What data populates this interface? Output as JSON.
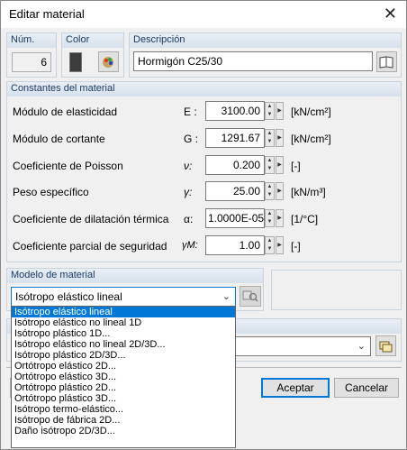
{
  "window": {
    "title": "Editar material",
    "close_glyph": "✕"
  },
  "header": {
    "num_label": "Núm.",
    "num_value": "6",
    "color_label": "Color",
    "color_value": "#3c3c3c",
    "desc_label": "Descripción",
    "desc_value": "Hormigón C25/30"
  },
  "constants": {
    "title": "Constantes del material",
    "rows": [
      {
        "label": "Módulo de elasticidad",
        "symbol": "E :",
        "value": "3100.00",
        "unit": "[kN/cm²]"
      },
      {
        "label": "Módulo de cortante",
        "symbol": "G :",
        "value": "1291.67",
        "unit": "[kN/cm²]"
      },
      {
        "label": "Coeficiente de Poisson",
        "symbol": "ν:",
        "value": "0.200",
        "unit": "[-]"
      },
      {
        "label": "Peso específico",
        "symbol": "γ:",
        "value": "25.00",
        "unit": "[kN/m³]"
      },
      {
        "label": "Coeficiente de dilatación térmica",
        "symbol": "α:",
        "value": "1.0000E-05",
        "unit": "[1/°C]"
      },
      {
        "label": "Coeficiente parcial de seguridad",
        "symbol": "γM:",
        "value": "1.00",
        "unit": "[-]"
      }
    ]
  },
  "model": {
    "title": "Modelo de material",
    "selected": "Isótropo elástico lineal",
    "options": [
      "Isótropo elástico lineal",
      "Isótropo elástico no lineal 1D",
      "Isótropo plástico 1D...",
      "Isótropo elástico no lineal 2D/3D...",
      "Isótropo plástico 2D/3D...",
      "Ortótropo elástico 2D...",
      "Ortótropo elástico 3D...",
      "Ortótropo plástico 2D...",
      "Ortótropo plástico 3D...",
      "Isótropo termo-elástico...",
      "Isótropo de fábrica 2D...",
      "Daño isótropo 2D/3D..."
    ]
  },
  "buttons": {
    "accept": "Aceptar",
    "cancel": "Cancelar"
  },
  "accent": "#0078d7"
}
